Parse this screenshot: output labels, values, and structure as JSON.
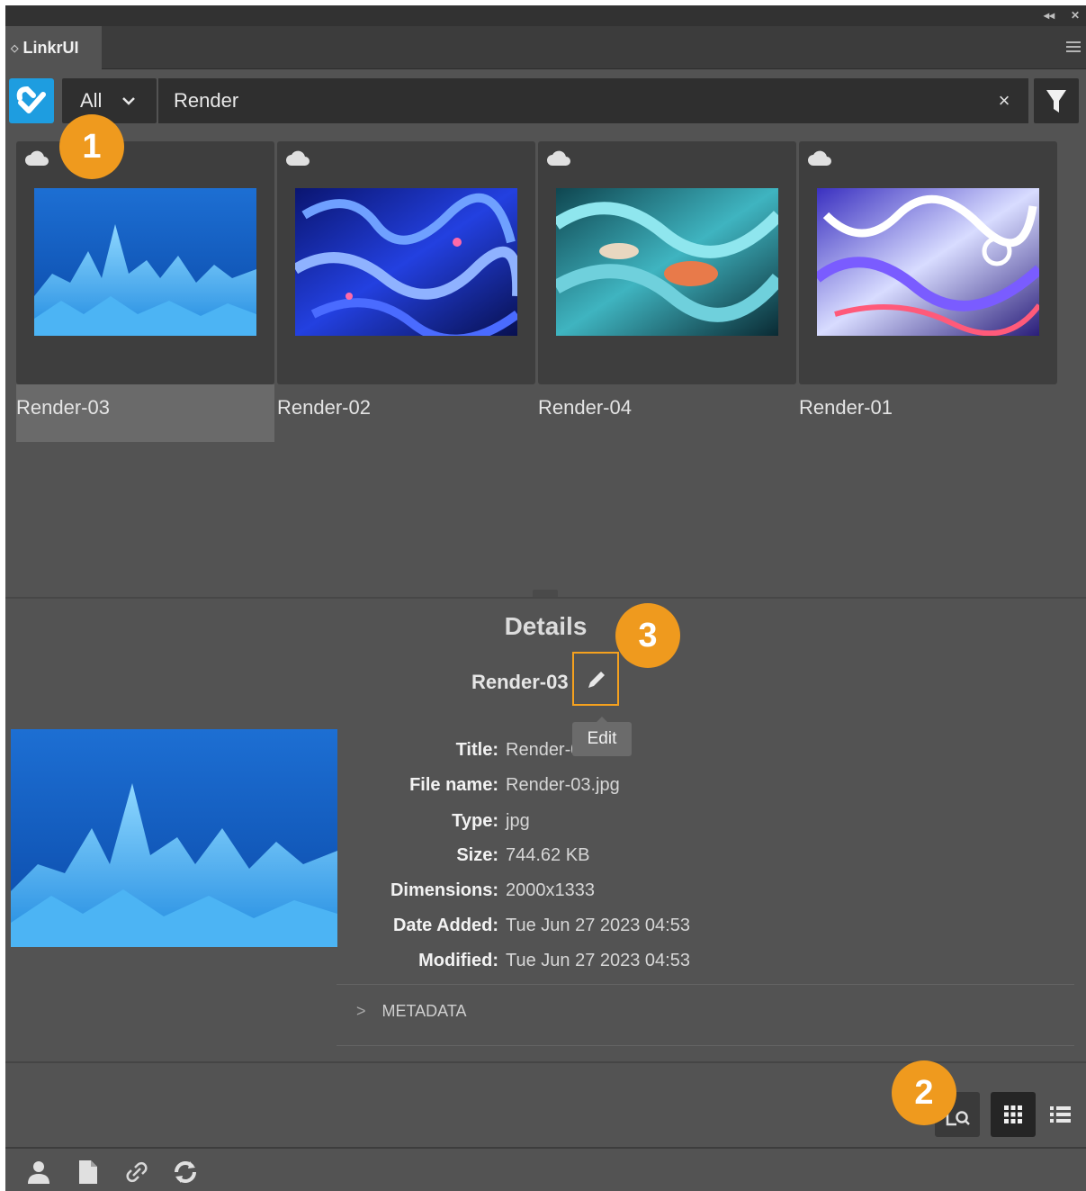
{
  "window": {
    "collapse_glyph": "◂◂",
    "close_glyph": "✕"
  },
  "tab": {
    "label": "LinkrUI",
    "arrows_glyph": "◇"
  },
  "search": {
    "scope_label": "All",
    "query": "Render",
    "clear_glyph": "×"
  },
  "assets": [
    {
      "label": "Render-03",
      "selected": true
    },
    {
      "label": "Render-02",
      "selected": false
    },
    {
      "label": "Render-04",
      "selected": false
    },
    {
      "label": "Render-01",
      "selected": false
    }
  ],
  "details": {
    "heading": "Details",
    "asset_name": "Render-03",
    "edit_tooltip": "Edit",
    "fields": [
      {
        "key": "Title:",
        "value": "Render-03"
      },
      {
        "key": "File name:",
        "value": "Render-03.jpg"
      },
      {
        "key": "Type:",
        "value": "jpg"
      },
      {
        "key": "Size:",
        "value": "744.62 KB"
      },
      {
        "key": "Dimensions:",
        "value": "2000x1333"
      },
      {
        "key": "Date Added:",
        "value": "Tue Jun 27 2023 04:53"
      },
      {
        "key": "Modified:",
        "value": "Tue Jun 27 2023 04:53"
      }
    ],
    "metadata_label": "METADATA"
  },
  "view_buttons": [
    "preview-search-icon",
    "grid-view-icon",
    "list-view-icon"
  ],
  "footer_icons": [
    "user-icon",
    "document-icon",
    "link-icon",
    "refresh-icon"
  ],
  "callouts": [
    "1",
    "2",
    "3"
  ],
  "colors": {
    "panel": "#535353",
    "accent_logo": "#1e9de0",
    "callout": "#ef9a1e",
    "highlight": "#f5a11e"
  }
}
